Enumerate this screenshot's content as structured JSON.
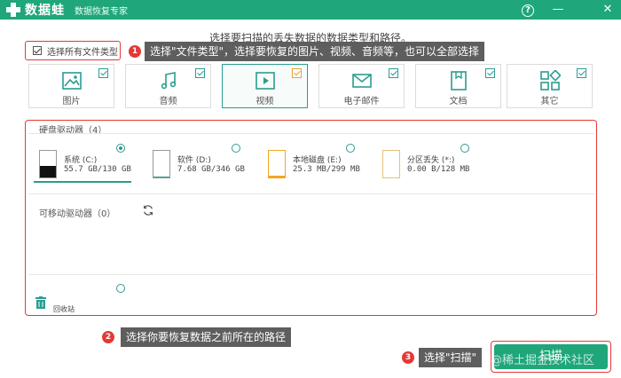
{
  "app": {
    "logo_text": "数据蛙",
    "subtitle": "数据恢复专家",
    "help_glyph": "?",
    "minimize_glyph": "—",
    "close_glyph": "✕"
  },
  "headline": "选择要扫描的丢失数据的数据类型和路径。",
  "select_all": {
    "label": "选择所有文件类型",
    "checked": true
  },
  "callouts": [
    {
      "num": "1",
      "text": "选择\"文件类型\"，选择要恢复的图片、视频、音频等，也可以全部选择"
    },
    {
      "num": "2",
      "text": "选择你要恢复数据之前所在的路径"
    },
    {
      "num": "3",
      "text": "选择\"扫描\""
    }
  ],
  "file_types": [
    {
      "label": "图片",
      "icon": "image-icon",
      "checked": true
    },
    {
      "label": "音频",
      "icon": "music-icon",
      "checked": true
    },
    {
      "label": "视频",
      "icon": "video-icon",
      "checked": true,
      "active": true
    },
    {
      "label": "电子邮件",
      "icon": "email-icon",
      "checked": true
    },
    {
      "label": "文档",
      "icon": "document-icon",
      "checked": true
    },
    {
      "label": "其它",
      "icon": "other-icon",
      "checked": true
    }
  ],
  "hard_drives": {
    "title": "硬盘驱动器（4）",
    "items": [
      {
        "name": "系统 (C:)",
        "size": "55.7 GB/130 GB",
        "selected": true,
        "fill": 0.43,
        "color": "#111111"
      },
      {
        "name": "软件 (D:)",
        "size": "7.68 GB/346 GB",
        "selected": false,
        "fill": 0.02,
        "color": "#2a9d8f"
      },
      {
        "name": "本地磁盘 (E:)",
        "size": "25.3 MB/299 MB",
        "selected": false,
        "fill": 0.08,
        "color": "#f5a623"
      },
      {
        "name": "分区丢失 (*:)",
        "size": "0.00  B/128 MB",
        "selected": false,
        "fill": 0.0,
        "color": "#e6c07a"
      }
    ]
  },
  "removable_drives": {
    "title": "可移动驱动器（0）"
  },
  "recycle_bin": {
    "label": "回收站",
    "selected": false
  },
  "scan_button": {
    "label": "扫描"
  },
  "watermark": "@稀土掘金技术社区"
}
